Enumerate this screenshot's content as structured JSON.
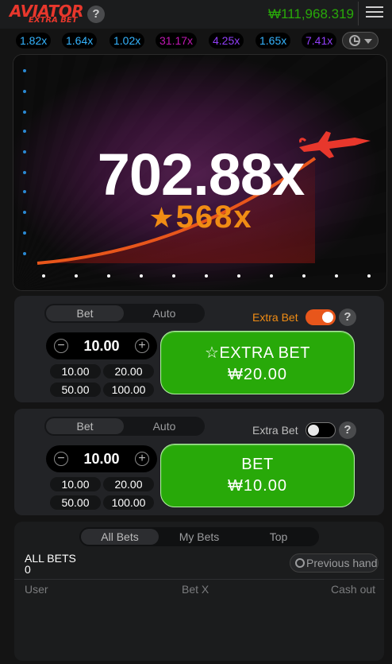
{
  "header": {
    "logo_main": "AVIATOR",
    "logo_sub": "EXTRA BET",
    "help": "?",
    "balance": "₩111,968.319",
    "colors": {
      "balance": "#28a909",
      "logo": "#e8372c"
    },
    "menu_icon": "hamburger-menu-icon"
  },
  "history": {
    "multipliers": [
      {
        "value": "1.82x",
        "color": "#34b4ff"
      },
      {
        "value": "1.64x",
        "color": "#34b4ff"
      },
      {
        "value": "1.02x",
        "color": "#34b4ff"
      },
      {
        "value": "31.17x",
        "color": "#c017b4"
      },
      {
        "value": "4.25x",
        "color": "#913ef8"
      },
      {
        "value": "1.65x",
        "color": "#34b4ff"
      },
      {
        "value": "7.41x",
        "color": "#913ef8"
      }
    ],
    "history_icon": "clock-icon"
  },
  "game": {
    "multiplier": "702.88x",
    "extra_multiplier": "568x",
    "extra_star": "★",
    "colors": {
      "curve": "#e8561b",
      "plane": "#e8372c",
      "extra": "#f08c14"
    }
  },
  "panel1": {
    "tabs": [
      "Bet",
      "Auto"
    ],
    "extra_bet_label": "Extra Bet",
    "extra_bet_on": true,
    "help": "?",
    "amount": "10.00",
    "minus": "−",
    "plus": "+",
    "quick": [
      "10.00",
      "20.00",
      "50.00",
      "100.00"
    ],
    "button_line1": "☆EXTRA BET",
    "button_line2": "₩20.00"
  },
  "panel2": {
    "tabs": [
      "Bet",
      "Auto"
    ],
    "extra_bet_label": "Extra Bet",
    "extra_bet_on": false,
    "help": "?",
    "amount": "10.00",
    "minus": "−",
    "plus": "+",
    "quick": [
      "10.00",
      "20.00",
      "50.00",
      "100.00"
    ],
    "button_line1": "BET",
    "button_line2": "₩10.00"
  },
  "bets": {
    "tabs": [
      "All Bets",
      "My Bets",
      "Top"
    ],
    "title": "ALL BETS",
    "count": "0",
    "previous_hand": "Previous hand",
    "columns": [
      "User",
      "Bet X",
      "Cash out"
    ]
  }
}
